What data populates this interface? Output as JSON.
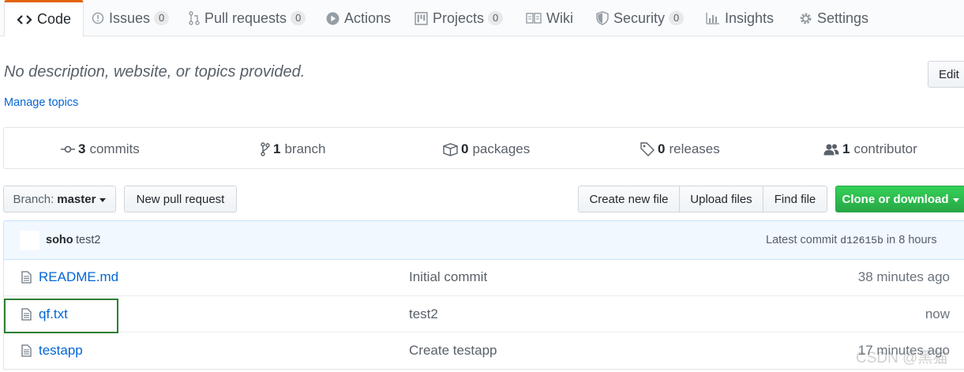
{
  "tabs": [
    {
      "label": "Code",
      "icon": "code-icon",
      "counter": null,
      "selected": true
    },
    {
      "label": "Issues",
      "icon": "issue-opened-icon",
      "counter": "0"
    },
    {
      "label": "Pull requests",
      "icon": "git-pull-request-icon",
      "counter": "0"
    },
    {
      "label": "Actions",
      "icon": "play-icon",
      "counter": null
    },
    {
      "label": "Projects",
      "icon": "project-icon",
      "counter": "0"
    },
    {
      "label": "Wiki",
      "icon": "book-icon",
      "counter": null
    },
    {
      "label": "Security",
      "icon": "shield-icon",
      "counter": "0"
    },
    {
      "label": "Insights",
      "icon": "graph-icon",
      "counter": null
    },
    {
      "label": "Settings",
      "icon": "gear-icon",
      "counter": null
    }
  ],
  "description": {
    "text": "No description, website, or topics provided.",
    "edit_label": "Edit",
    "manage_topics": "Manage topics"
  },
  "summary": {
    "commits": {
      "num": "3",
      "label": "commits"
    },
    "branch": {
      "num": "1",
      "label": "branch"
    },
    "packages": {
      "num": "0",
      "label": "packages"
    },
    "releases": {
      "num": "0",
      "label": "releases"
    },
    "contributors": {
      "num": "1",
      "label": "contributor"
    }
  },
  "toolbar": {
    "branch_label": "Branch:",
    "branch_value": "master",
    "new_pull_request": "New pull request",
    "create_new_file": "Create new file",
    "upload_files": "Upload files",
    "find_file": "Find file",
    "clone_or_download": "Clone or download"
  },
  "commit_tease": {
    "author": "soho",
    "message": "test2",
    "latest_prefix": "Latest commit",
    "sha": "d12615b",
    "age": "in 8 hours"
  },
  "files": [
    {
      "name": "README.md",
      "message": "Initial commit",
      "age": "38 minutes ago"
    },
    {
      "name": "qf.txt",
      "message": "test2",
      "age": "now"
    },
    {
      "name": "testapp",
      "message": "Create testapp",
      "age": "17 minutes ago"
    }
  ],
  "watermark": "CSDN @黑猫",
  "colors": {
    "accent_tab": "#e36209",
    "link": "#0366d6",
    "clone_button": "#28a745",
    "highlight_box": "#2e7d32"
  }
}
